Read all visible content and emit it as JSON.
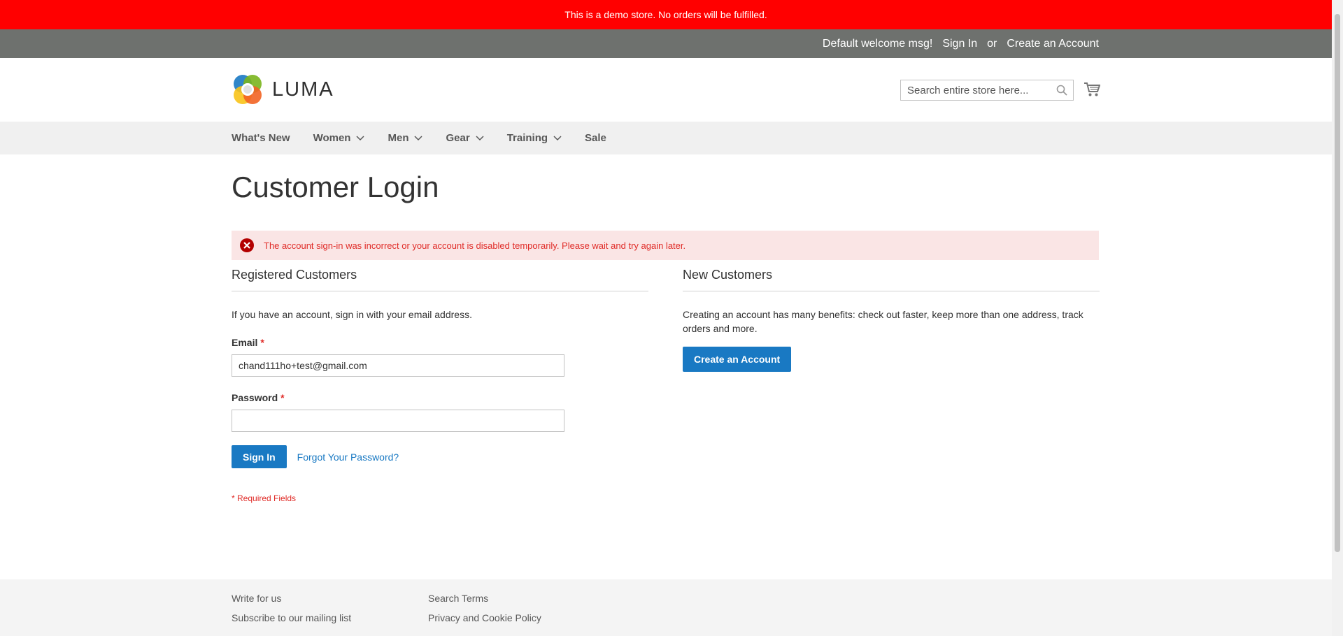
{
  "demo_notice": "This is a demo store. No orders will be fulfilled.",
  "panel": {
    "welcome": "Default welcome msg!",
    "sign_in": "Sign In",
    "or": "or",
    "create_account": "Create an Account"
  },
  "header": {
    "logo_text": "LUMA",
    "search_placeholder": "Search entire store here...",
    "search_icon": "search-icon",
    "cart_icon": "cart-icon"
  },
  "nav": {
    "items": [
      {
        "label": "What's New",
        "dropdown": false
      },
      {
        "label": "Women",
        "dropdown": true
      },
      {
        "label": "Men",
        "dropdown": true
      },
      {
        "label": "Gear",
        "dropdown": true
      },
      {
        "label": "Training",
        "dropdown": true
      },
      {
        "label": "Sale",
        "dropdown": false
      }
    ]
  },
  "page": {
    "title": "Customer Login",
    "error_message": "The account sign-in was incorrect or your account is disabled temporarily. Please wait and try again later."
  },
  "registered": {
    "title": "Registered Customers",
    "intro": "If you have an account, sign in with your email address.",
    "email_label": "Email",
    "email_value": "chand111ho+test@gmail.com",
    "password_label": "Password",
    "password_value": "",
    "required_mark": "*",
    "sign_in_button": "Sign In",
    "forgot_link": "Forgot Your Password?",
    "required_note": "* Required Fields"
  },
  "new_customers": {
    "title": "New Customers",
    "text": "Creating an account has many benefits: check out faster, keep more than one address, track orders and more.",
    "create_button": "Create an Account"
  },
  "footer": {
    "col1": [
      "Write for us",
      "Subscribe to our mailing list"
    ],
    "col2": [
      "Search Terms",
      "Privacy and Cookie Policy"
    ]
  },
  "colors": {
    "demo_bar": "#ff0000",
    "panel_header": "#6e716e",
    "primary": "#1979c3",
    "error_bg": "#fae5e5",
    "error_text": "#e02b27"
  }
}
